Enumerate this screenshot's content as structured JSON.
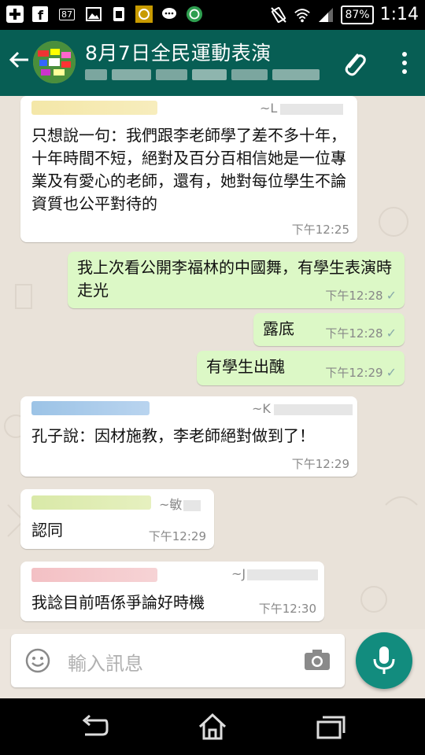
{
  "status_bar": {
    "notif_badge": "87",
    "battery": "87%",
    "time": "1:14"
  },
  "header": {
    "title": "8月7日全民運動表演"
  },
  "messages": [
    {
      "direction": "in",
      "sender_suffix": "~L",
      "text": "只想說一句：我們跟李老師學了差不多十年，十年時間不短，絕對及百分百相信她是一位專業及有愛心的老師，還有，她對每位學生不論資質也公平對待的",
      "time": "下午12:25"
    },
    {
      "direction": "out",
      "text": "我上次看公開李福林的中國舞，有學生表演時走光",
      "time": "下午12:28"
    },
    {
      "direction": "out",
      "text": "露底",
      "time": "下午12:28"
    },
    {
      "direction": "out",
      "text": "有學生出醜",
      "time": "下午12:29"
    },
    {
      "direction": "in",
      "sender_suffix": "~K",
      "text": "孔子說：因材施教，李老師絕對做到了！",
      "time": "下午12:29"
    },
    {
      "direction": "in",
      "sender_suffix": "~敏",
      "text": "認同",
      "time": "下午12:29"
    },
    {
      "direction": "in",
      "sender_suffix": "~J",
      "text": "我諗目前唔係爭論好時機",
      "time": "下午12:30"
    }
  ],
  "composer": {
    "placeholder": "輸入訊息"
  },
  "colors": {
    "app_bar": "#075e54",
    "outgoing_bubble": "#dcf8c6",
    "incoming_bubble": "#ffffff",
    "fab": "#128c7e"
  }
}
